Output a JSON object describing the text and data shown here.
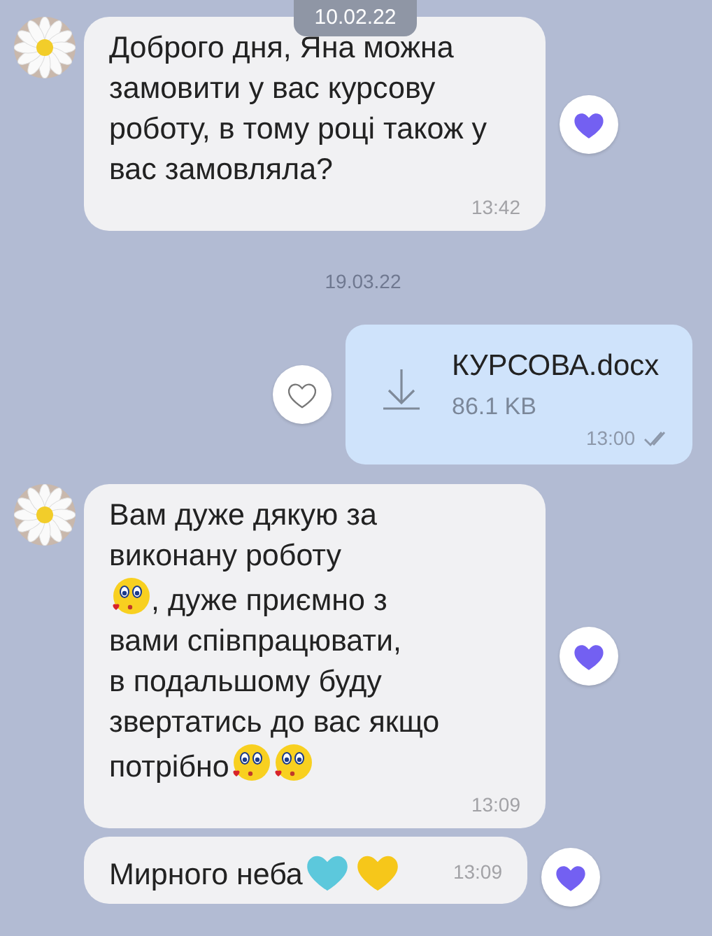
{
  "pinned_date": {
    "text": "10.02.22"
  },
  "messages": [
    {
      "kind": "incoming",
      "avatar": true,
      "inline_time": false,
      "parts": [
        {
          "kind": "text",
          "text": "Доброго дня, Яна можна\nзамовити у вас курсову\nроботу, в тому році також у\nвас замовляла?"
        }
      ],
      "time": "13:42",
      "liked": true
    },
    {
      "kind": "date",
      "text": "19.03.22"
    },
    {
      "kind": "file",
      "file_name": "КУРСОВА.docx",
      "size": "86.1 KB",
      "time": "13:00",
      "read": true,
      "liked": false
    },
    {
      "kind": "incoming",
      "avatar": true,
      "inline_time": false,
      "parts": [
        {
          "kind": "text",
          "text": "Вам дуже дякую за\nвиконану роботу"
        },
        {
          "kind": "kiss"
        },
        {
          "kind": "text",
          "text": ", дуже приємно з"
        },
        {
          "kind": "text",
          "text": "вами співпрацювати,\nв подальшому буду\nзвертатись до вас якщо"
        },
        {
          "kind": "text",
          "text": "потрібно"
        },
        {
          "kind": "kiss"
        },
        {
          "kind": "kiss"
        }
      ],
      "time": "13:09",
      "liked": true
    },
    {
      "kind": "incoming",
      "avatar": false,
      "inline_time": true,
      "parts": [
        {
          "kind": "text",
          "text": "Мирного неба"
        },
        {
          "kind": "heart",
          "color": "#5cc8dc"
        },
        {
          "kind": "heart",
          "color": "#f6c71a"
        }
      ],
      "time": "13:09",
      "liked": true
    }
  ]
}
